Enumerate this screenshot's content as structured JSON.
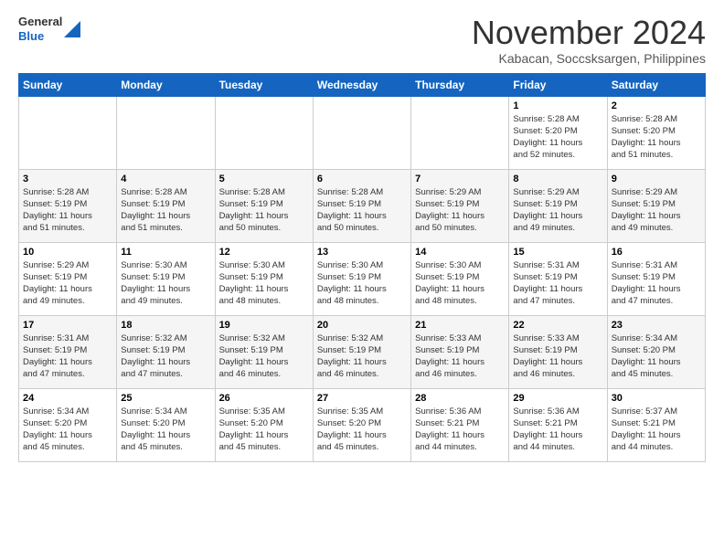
{
  "header": {
    "logo": {
      "line1": "General",
      "line2": "Blue"
    },
    "title": "November 2024",
    "subtitle": "Kabacan, Soccsksargen, Philippines"
  },
  "calendar": {
    "weekdays": [
      "Sunday",
      "Monday",
      "Tuesday",
      "Wednesday",
      "Thursday",
      "Friday",
      "Saturday"
    ],
    "weeks": [
      [
        {
          "day": "",
          "info": ""
        },
        {
          "day": "",
          "info": ""
        },
        {
          "day": "",
          "info": ""
        },
        {
          "day": "",
          "info": ""
        },
        {
          "day": "",
          "info": ""
        },
        {
          "day": "1",
          "info": "Sunrise: 5:28 AM\nSunset: 5:20 PM\nDaylight: 11 hours\nand 52 minutes."
        },
        {
          "day": "2",
          "info": "Sunrise: 5:28 AM\nSunset: 5:20 PM\nDaylight: 11 hours\nand 51 minutes."
        }
      ],
      [
        {
          "day": "3",
          "info": "Sunrise: 5:28 AM\nSunset: 5:19 PM\nDaylight: 11 hours\nand 51 minutes."
        },
        {
          "day": "4",
          "info": "Sunrise: 5:28 AM\nSunset: 5:19 PM\nDaylight: 11 hours\nand 51 minutes."
        },
        {
          "day": "5",
          "info": "Sunrise: 5:28 AM\nSunset: 5:19 PM\nDaylight: 11 hours\nand 50 minutes."
        },
        {
          "day": "6",
          "info": "Sunrise: 5:28 AM\nSunset: 5:19 PM\nDaylight: 11 hours\nand 50 minutes."
        },
        {
          "day": "7",
          "info": "Sunrise: 5:29 AM\nSunset: 5:19 PM\nDaylight: 11 hours\nand 50 minutes."
        },
        {
          "day": "8",
          "info": "Sunrise: 5:29 AM\nSunset: 5:19 PM\nDaylight: 11 hours\nand 49 minutes."
        },
        {
          "day": "9",
          "info": "Sunrise: 5:29 AM\nSunset: 5:19 PM\nDaylight: 11 hours\nand 49 minutes."
        }
      ],
      [
        {
          "day": "10",
          "info": "Sunrise: 5:29 AM\nSunset: 5:19 PM\nDaylight: 11 hours\nand 49 minutes."
        },
        {
          "day": "11",
          "info": "Sunrise: 5:30 AM\nSunset: 5:19 PM\nDaylight: 11 hours\nand 49 minutes."
        },
        {
          "day": "12",
          "info": "Sunrise: 5:30 AM\nSunset: 5:19 PM\nDaylight: 11 hours\nand 48 minutes."
        },
        {
          "day": "13",
          "info": "Sunrise: 5:30 AM\nSunset: 5:19 PM\nDaylight: 11 hours\nand 48 minutes."
        },
        {
          "day": "14",
          "info": "Sunrise: 5:30 AM\nSunset: 5:19 PM\nDaylight: 11 hours\nand 48 minutes."
        },
        {
          "day": "15",
          "info": "Sunrise: 5:31 AM\nSunset: 5:19 PM\nDaylight: 11 hours\nand 47 minutes."
        },
        {
          "day": "16",
          "info": "Sunrise: 5:31 AM\nSunset: 5:19 PM\nDaylight: 11 hours\nand 47 minutes."
        }
      ],
      [
        {
          "day": "17",
          "info": "Sunrise: 5:31 AM\nSunset: 5:19 PM\nDaylight: 11 hours\nand 47 minutes."
        },
        {
          "day": "18",
          "info": "Sunrise: 5:32 AM\nSunset: 5:19 PM\nDaylight: 11 hours\nand 47 minutes."
        },
        {
          "day": "19",
          "info": "Sunrise: 5:32 AM\nSunset: 5:19 PM\nDaylight: 11 hours\nand 46 minutes."
        },
        {
          "day": "20",
          "info": "Sunrise: 5:32 AM\nSunset: 5:19 PM\nDaylight: 11 hours\nand 46 minutes."
        },
        {
          "day": "21",
          "info": "Sunrise: 5:33 AM\nSunset: 5:19 PM\nDaylight: 11 hours\nand 46 minutes."
        },
        {
          "day": "22",
          "info": "Sunrise: 5:33 AM\nSunset: 5:19 PM\nDaylight: 11 hours\nand 46 minutes."
        },
        {
          "day": "23",
          "info": "Sunrise: 5:34 AM\nSunset: 5:20 PM\nDaylight: 11 hours\nand 45 minutes."
        }
      ],
      [
        {
          "day": "24",
          "info": "Sunrise: 5:34 AM\nSunset: 5:20 PM\nDaylight: 11 hours\nand 45 minutes."
        },
        {
          "day": "25",
          "info": "Sunrise: 5:34 AM\nSunset: 5:20 PM\nDaylight: 11 hours\nand 45 minutes."
        },
        {
          "day": "26",
          "info": "Sunrise: 5:35 AM\nSunset: 5:20 PM\nDaylight: 11 hours\nand 45 minutes."
        },
        {
          "day": "27",
          "info": "Sunrise: 5:35 AM\nSunset: 5:20 PM\nDaylight: 11 hours\nand 45 minutes."
        },
        {
          "day": "28",
          "info": "Sunrise: 5:36 AM\nSunset: 5:21 PM\nDaylight: 11 hours\nand 44 minutes."
        },
        {
          "day": "29",
          "info": "Sunrise: 5:36 AM\nSunset: 5:21 PM\nDaylight: 11 hours\nand 44 minutes."
        },
        {
          "day": "30",
          "info": "Sunrise: 5:37 AM\nSunset: 5:21 PM\nDaylight: 11 hours\nand 44 minutes."
        }
      ]
    ]
  }
}
